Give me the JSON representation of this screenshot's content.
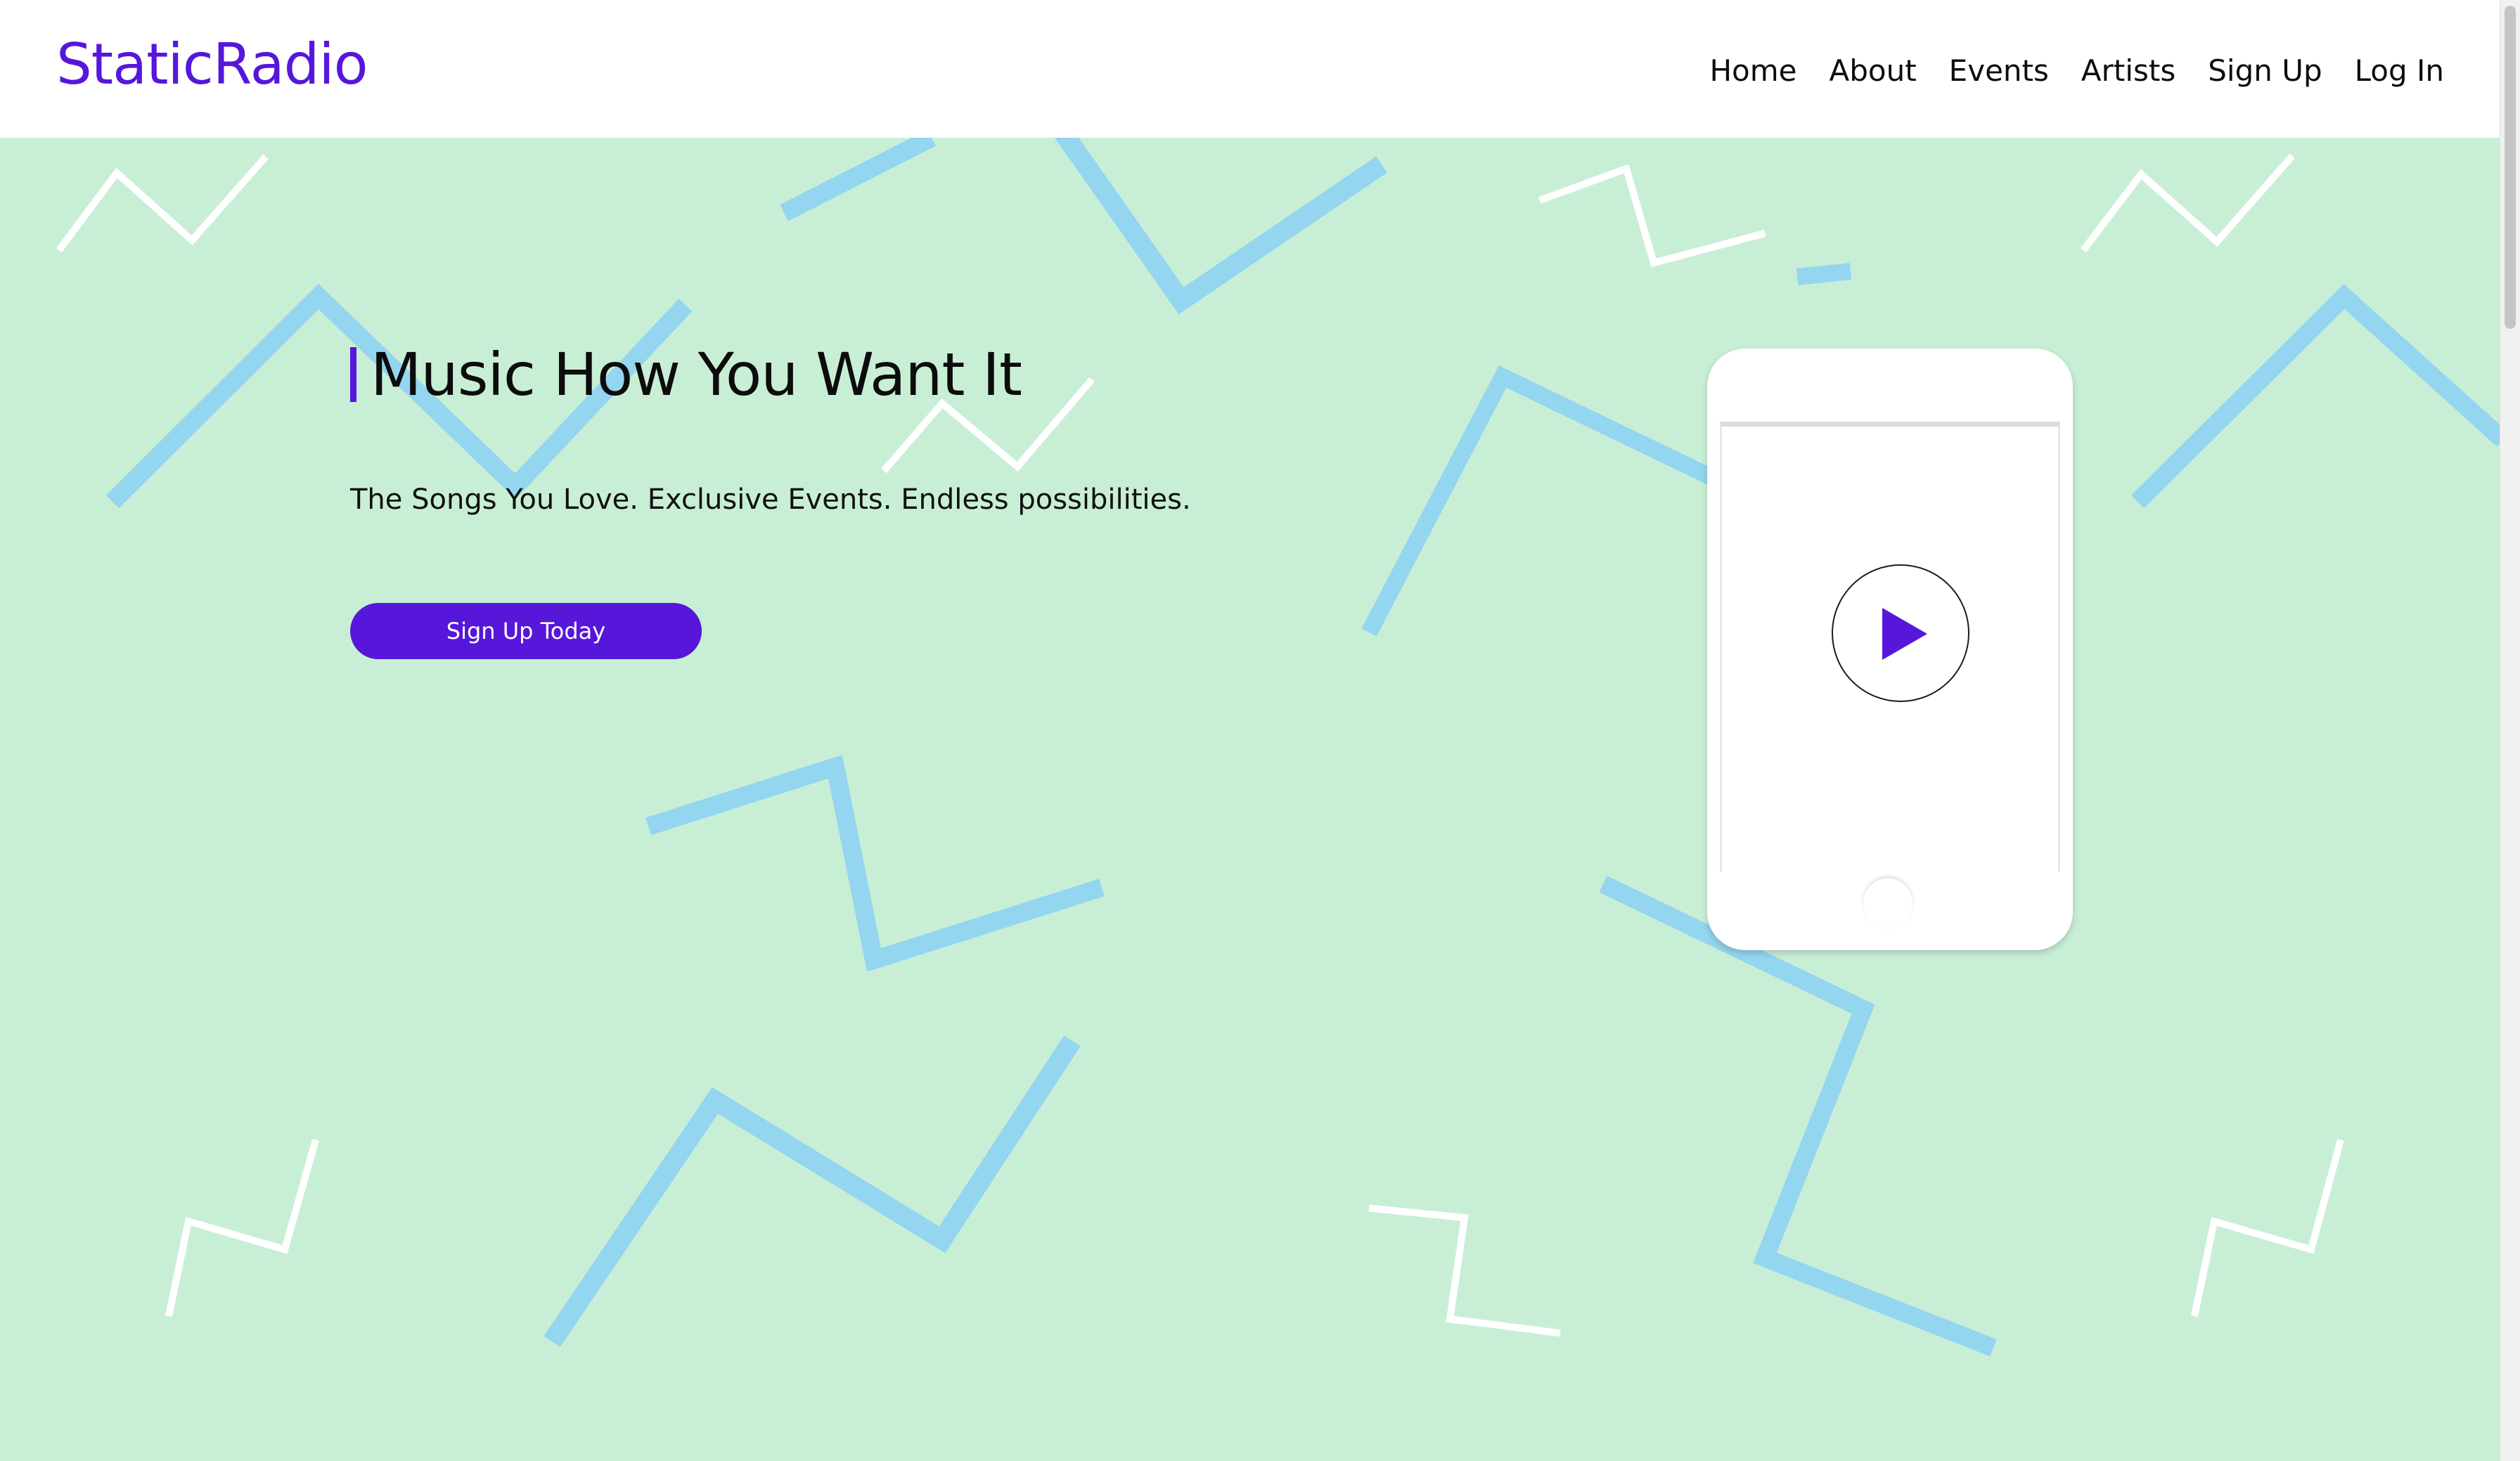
{
  "brand": {
    "name": "StaticRadio"
  },
  "nav": {
    "items": [
      {
        "label": "Home"
      },
      {
        "label": "About"
      },
      {
        "label": "Events"
      },
      {
        "label": "Artists"
      },
      {
        "label": "Sign Up"
      },
      {
        "label": "Log In"
      }
    ]
  },
  "hero": {
    "headline": "Music How You Want It",
    "tagline": "The Songs You Love. Exclusive Events. Endless possibilities.",
    "cta_label": "Sign Up Today"
  },
  "phone": {
    "icon": "play-icon"
  },
  "colors": {
    "brand_purple": "#5617db",
    "hero_background": "#c8efd6",
    "zigzag_blue": "#94d5f0",
    "zigzag_white": "#ffffff"
  }
}
